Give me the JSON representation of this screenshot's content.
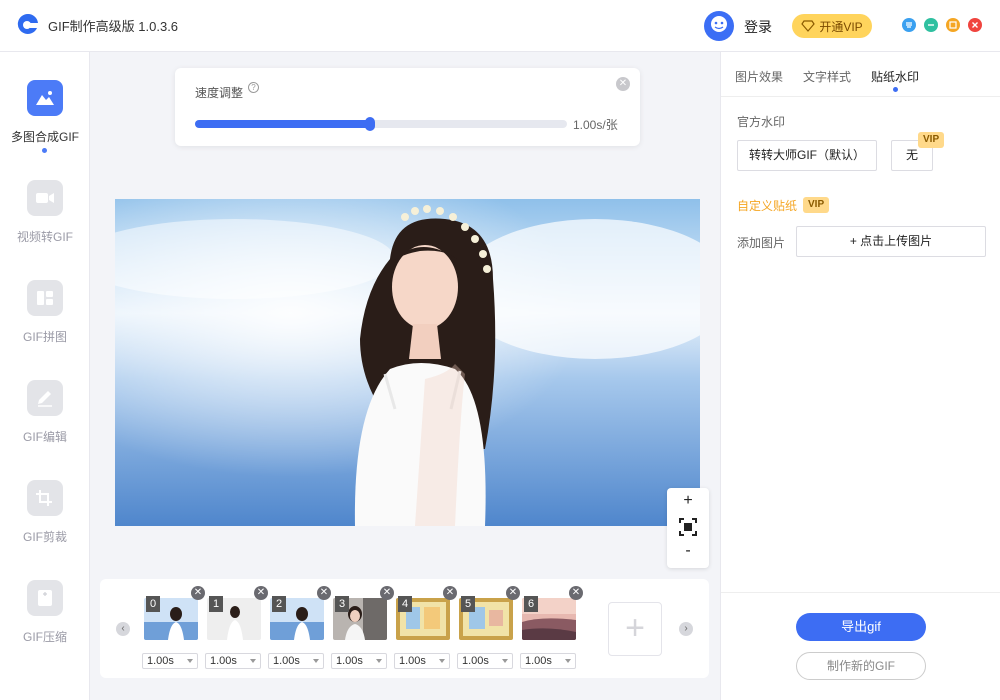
{
  "app": {
    "title": "GIF制作高级版 1.0.3.6"
  },
  "header": {
    "login_label": "登录",
    "vip_label": "开通VIP",
    "window_buttons": [
      {
        "name": "menu",
        "color": "#3aa0f0"
      },
      {
        "name": "minimize",
        "color": "#2fc0a0"
      },
      {
        "name": "maximize",
        "color": "#f5a623"
      },
      {
        "name": "close",
        "color": "#f0443e"
      }
    ]
  },
  "sidebar": {
    "items": [
      {
        "label": "多图合成GIF",
        "icon": "mountain-image-icon",
        "active": true
      },
      {
        "label": "视频转GIF",
        "icon": "video-icon",
        "active": false
      },
      {
        "label": "GIF拼图",
        "icon": "collage-icon",
        "active": false
      },
      {
        "label": "GIF编辑",
        "icon": "pencil-icon",
        "active": false
      },
      {
        "label": "GIF剪裁",
        "icon": "crop-icon",
        "active": false
      },
      {
        "label": "GIF压缩",
        "icon": "compress-icon",
        "active": false
      }
    ]
  },
  "speed": {
    "title": "速度调整",
    "value_text": "1.00s/张",
    "slider_fraction": 0.47
  },
  "zoom": {
    "in": "+",
    "out": "-"
  },
  "filmstrip": {
    "frames": [
      {
        "index": "0",
        "duration": "1.00s",
        "thumb": "woman-sea-bright"
      },
      {
        "index": "1",
        "duration": "1.00s",
        "thumb": "woman-white"
      },
      {
        "index": "2",
        "duration": "1.00s",
        "thumb": "woman-sea-bright"
      },
      {
        "index": "3",
        "duration": "1.00s",
        "thumb": "woman-indoor"
      },
      {
        "index": "4",
        "duration": "1.00s",
        "thumb": "framed-picture"
      },
      {
        "index": "5",
        "duration": "1.00s",
        "thumb": "framed-picture"
      },
      {
        "index": "6",
        "duration": "1.00s",
        "thumb": "sunset-shore"
      }
    ]
  },
  "right_panel": {
    "tabs": [
      {
        "label": "图片效果",
        "active": false
      },
      {
        "label": "文字样式",
        "active": false
      },
      {
        "label": "贴纸水印",
        "active": true
      }
    ],
    "official_watermark_label": "官方水印",
    "watermark_default": "转转大师GIF（默认）",
    "watermark_none": "无",
    "vip_badge": "VIP",
    "custom_sticker_label": "自定义贴纸",
    "add_image_label": "添加图片",
    "upload_button": "+ 点击上传图片",
    "export_button": "导出gif",
    "new_button": "制作新的GIF"
  },
  "colors": {
    "accent": "#3d6df3",
    "vip": "#ffd45c",
    "custom_label": "#f5a623"
  }
}
